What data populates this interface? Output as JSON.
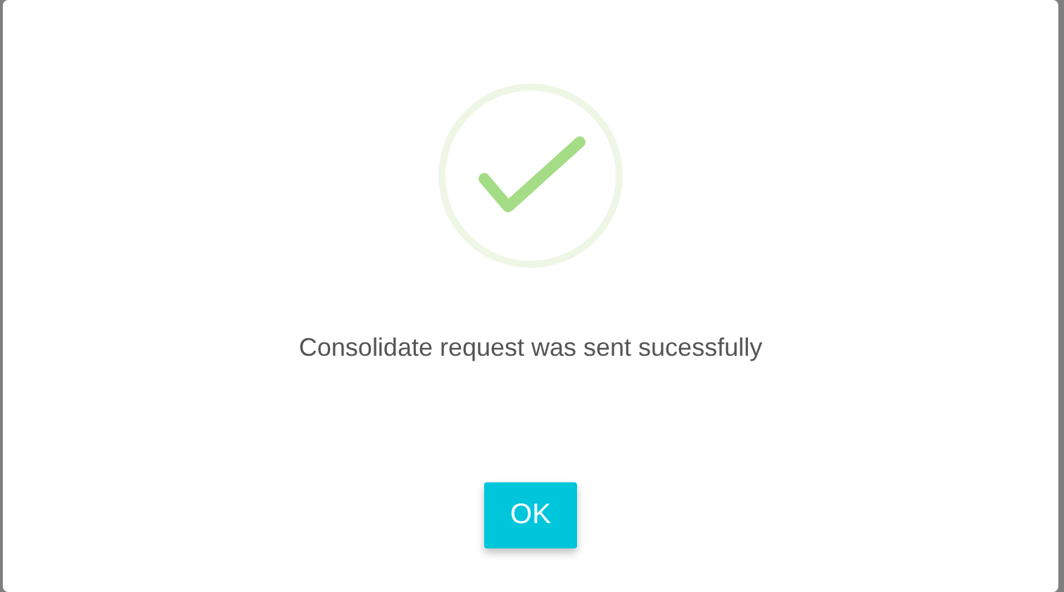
{
  "dialog": {
    "message": "Consolidate request was sent sucessfully",
    "buttons": [
      {
        "label": "OK"
      }
    ]
  }
}
